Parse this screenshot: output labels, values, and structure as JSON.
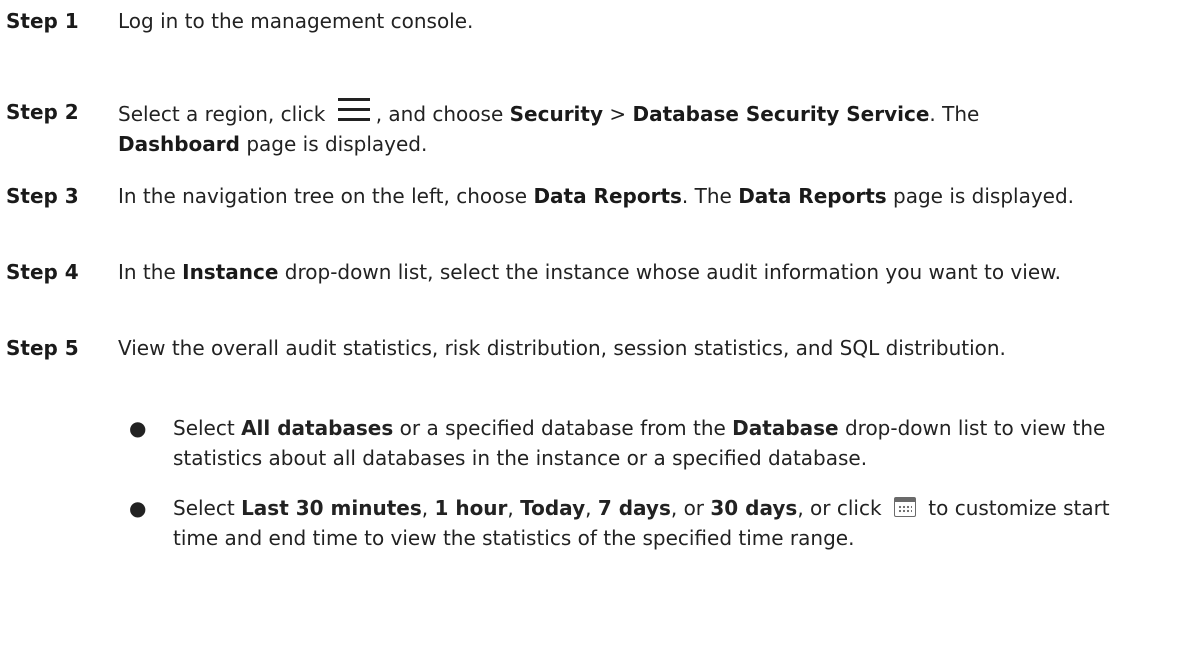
{
  "steps": [
    {
      "label": "Step 1",
      "text": "Log in to the management console."
    },
    {
      "label": "Step 2",
      "t1": "Select a region, click ",
      "icon": "hamburger-menu-icon",
      "t2": ", and choose ",
      "b1": "Security",
      "t3": " > ",
      "b2": "Database Security Service",
      "t4": ". The ",
      "b3": "Dashboard",
      "t5": " page is displayed."
    },
    {
      "label": "Step 3",
      "t1": "In the navigation tree on the left, choose ",
      "b1": "Data Reports",
      "t2": ". The ",
      "b2": "Data Reports",
      "t3": " page is displayed."
    },
    {
      "label": "Step 4",
      "t1": "In the ",
      "b1": "Instance",
      "t2": " drop-down list, select the instance whose audit information you want to view."
    },
    {
      "label": "Step 5",
      "text": "View the overall audit statistics, risk distribution, session statistics, and SQL distribution.",
      "bullets": [
        {
          "t1": "Select ",
          "b1": "All databases",
          "t2": " or a specified database from the ",
          "b2": "Database",
          "t3": " drop-down list to view the statistics about all databases in the instance or a specified database."
        },
        {
          "t1": "Select ",
          "b1": "Last 30 minutes",
          "t2": ", ",
          "b2": "1 hour",
          "t3": ", ",
          "b3": "Today",
          "t4": ", ",
          "b4": "7 days",
          "t5": ", or ",
          "b5": "30 days",
          "t6": ", or click ",
          "icon": "calendar-icon",
          "t7": " to customize start time and end time to view the statistics of the specified time range."
        }
      ]
    }
  ],
  "bullet_char": "●"
}
